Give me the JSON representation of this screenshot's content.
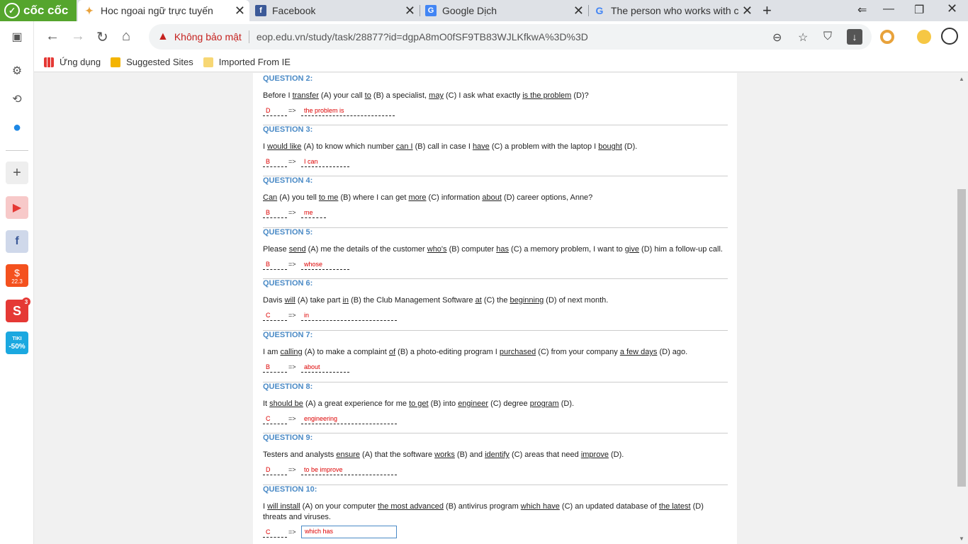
{
  "browser": {
    "brand": "cốc cốc",
    "tabs": [
      {
        "title": "Hoc ngoai ngữ trực tuyến",
        "active": true
      },
      {
        "title": "Facebook",
        "active": false
      },
      {
        "title": "Google Dịch",
        "active": false
      },
      {
        "title": "The person who works with c",
        "active": false
      }
    ],
    "address": {
      "security_label": "Không bảo mật",
      "url": "eop.edu.vn/study/task/28877?id=dgpA8mO0fSF9TB83WJLKfkwA%3D%3D"
    },
    "bookmarks": [
      "Ứng dụng",
      "Suggested Sites",
      "Imported From IE"
    ],
    "sidebar_badge": "3",
    "tiki_label": "TIKI",
    "tiki_discount": "-50%",
    "shopee_label": "22.3"
  },
  "colors": {
    "question_title": "#4a8ac6",
    "answer": "#dd0000",
    "brand_green": "#55a52d"
  },
  "questions": [
    {
      "title": "QUESTION 2:",
      "parts": [
        {
          "t": "Before I ",
          "u": false
        },
        {
          "t": "transfer",
          "u": true
        },
        {
          "t": " (A) your call ",
          "u": false
        },
        {
          "t": "to",
          "u": true
        },
        {
          "t": " (B) a specialist, ",
          "u": false
        },
        {
          "t": "may",
          "u": true
        },
        {
          "t": " (C) I ask what exactly ",
          "u": false
        },
        {
          "t": "is the problem",
          "u": true
        },
        {
          "t": " (D)?",
          "u": false
        }
      ],
      "letter": "D",
      "arrow": "=>",
      "answer": "the problem is"
    },
    {
      "title": "QUESTION 3:",
      "parts": [
        {
          "t": "I ",
          "u": false
        },
        {
          "t": "would like",
          "u": true
        },
        {
          "t": " (A) to know which number ",
          "u": false
        },
        {
          "t": "can I",
          "u": true
        },
        {
          "t": " (B) call in case I ",
          "u": false
        },
        {
          "t": "have",
          "u": true
        },
        {
          "t": " (C) a problem with the laptop I ",
          "u": false
        },
        {
          "t": "bought",
          "u": true
        },
        {
          "t": " (D).",
          "u": false
        }
      ],
      "letter": "B",
      "arrow": "=>",
      "answer": "I can"
    },
    {
      "title": "QUESTION 4:",
      "parts": [
        {
          "t": "Can",
          "u": true
        },
        {
          "t": " (A) you tell ",
          "u": false
        },
        {
          "t": "to me",
          "u": true
        },
        {
          "t": " (B) where I can get ",
          "u": false
        },
        {
          "t": "more",
          "u": true
        },
        {
          "t": " (C) information ",
          "u": false
        },
        {
          "t": "about",
          "u": true
        },
        {
          "t": " (D) career options, Anne?",
          "u": false
        }
      ],
      "letter": "B",
      "arrow": "=>",
      "answer": "me"
    },
    {
      "title": "QUESTION 5:",
      "parts": [
        {
          "t": "Please ",
          "u": false
        },
        {
          "t": "send",
          "u": true
        },
        {
          "t": " (A) me the details of the customer ",
          "u": false
        },
        {
          "t": "who's",
          "u": true
        },
        {
          "t": " (B) computer ",
          "u": false
        },
        {
          "t": "has",
          "u": true
        },
        {
          "t": " (C) a memory problem, I want to ",
          "u": false
        },
        {
          "t": "give",
          "u": true
        },
        {
          "t": " (D) him a follow-up call.",
          "u": false
        }
      ],
      "letter": "B",
      "arrow": "=>",
      "answer": "whose"
    },
    {
      "title": "QUESTION 6:",
      "parts": [
        {
          "t": "Davis ",
          "u": false
        },
        {
          "t": "will",
          "u": true
        },
        {
          "t": " (A) take part ",
          "u": false
        },
        {
          "t": "in",
          "u": true
        },
        {
          "t": " (B) the Club Management Software ",
          "u": false
        },
        {
          "t": "at",
          "u": true
        },
        {
          "t": " (C) the ",
          "u": false
        },
        {
          "t": "beginning",
          "u": true
        },
        {
          "t": " (D) of next month.",
          "u": false
        }
      ],
      "letter": "C",
      "arrow": "=>",
      "answer": "in"
    },
    {
      "title": "QUESTION 7:",
      "parts": [
        {
          "t": "I am ",
          "u": false
        },
        {
          "t": "calling",
          "u": true
        },
        {
          "t": " (A) to make a complaint ",
          "u": false
        },
        {
          "t": "of",
          "u": true
        },
        {
          "t": " (B) a photo-editing program I ",
          "u": false
        },
        {
          "t": "purchased",
          "u": true
        },
        {
          "t": " (C) from your company ",
          "u": false
        },
        {
          "t": "a few days",
          "u": true
        },
        {
          "t": " (D) ago.",
          "u": false
        }
      ],
      "letter": "B",
      "arrow": "=>",
      "answer": "about"
    },
    {
      "title": "QUESTION 8:",
      "parts": [
        {
          "t": "It ",
          "u": false
        },
        {
          "t": "should be",
          "u": true
        },
        {
          "t": " (A) a great experience for me ",
          "u": false
        },
        {
          "t": "to get",
          "u": true
        },
        {
          "t": " (B) into ",
          "u": false
        },
        {
          "t": "engineer",
          "u": true
        },
        {
          "t": " (C) degree ",
          "u": false
        },
        {
          "t": "program",
          "u": true
        },
        {
          "t": " (D).",
          "u": false
        }
      ],
      "letter": "C",
      "arrow": "=>",
      "answer": "engineering"
    },
    {
      "title": "QUESTION 9:",
      "parts": [
        {
          "t": "Testers and analysts ",
          "u": false
        },
        {
          "t": "ensure",
          "u": true
        },
        {
          "t": " (A) that the software ",
          "u": false
        },
        {
          "t": "works",
          "u": true
        },
        {
          "t": " (B) and ",
          "u": false
        },
        {
          "t": "identify",
          "u": true
        },
        {
          "t": " (C) areas that need ",
          "u": false
        },
        {
          "t": "improve",
          "u": true
        },
        {
          "t": " (D).",
          "u": false
        }
      ],
      "letter": "D",
      "arrow": "=>",
      "answer": "to be improve"
    },
    {
      "title": "QUESTION 10:",
      "parts": [
        {
          "t": "I ",
          "u": false
        },
        {
          "t": "will install",
          "u": true
        },
        {
          "t": " (A) on your computer ",
          "u": false
        },
        {
          "t": "the most advanced",
          "u": true
        },
        {
          "t": " (B) antivirus program ",
          "u": false
        },
        {
          "t": "which have",
          "u": true
        },
        {
          "t": " (C) an updated database of ",
          "u": false
        },
        {
          "t": "the latest",
          "u": true
        },
        {
          "t": " (D) threats and viruses.",
          "u": false
        }
      ],
      "letter": "C",
      "arrow": "=>",
      "answer": "which has"
    }
  ]
}
